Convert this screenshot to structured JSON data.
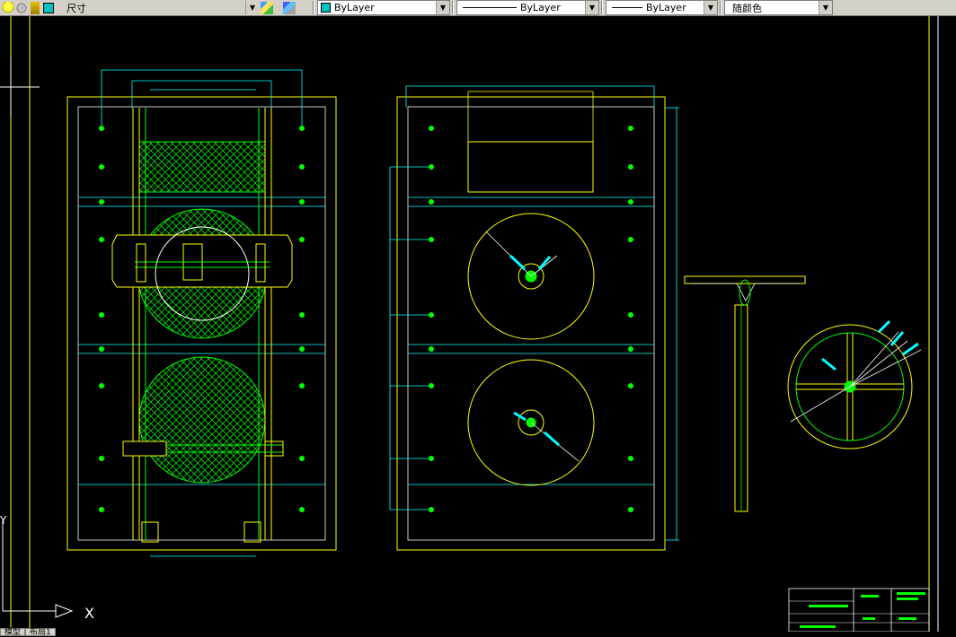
{
  "toolbar": {
    "layer_value": "尺寸",
    "color_value": "ByLayer",
    "linetype_value": "ByLayer",
    "lineweight_value": "ByLayer",
    "plotstyle_value": "随颜色",
    "color_accent": "#00c0c0"
  },
  "canvas": {
    "background": "#000000",
    "ucs_x_label": "X",
    "ucs_y_label": "Y"
  },
  "tabs": {
    "model_label": "模型",
    "layout_label": "布局1"
  }
}
